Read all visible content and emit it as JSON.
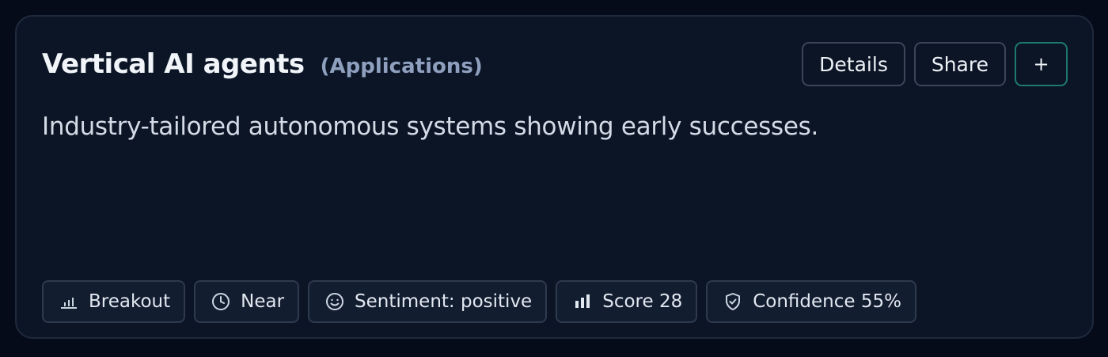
{
  "card": {
    "title": "Vertical AI agents",
    "category": "(Applications)",
    "description": "Industry-tailored autonomous systems showing early successes.",
    "actions": {
      "details_label": "Details",
      "share_label": "Share",
      "add_label": "+"
    },
    "chips": [
      {
        "icon": "bar-chart-icon",
        "label": "Breakout"
      },
      {
        "icon": "clock-icon",
        "label": "Near"
      },
      {
        "icon": "smiley-icon",
        "label": "Sentiment: positive"
      },
      {
        "icon": "signal-bars-icon",
        "label": "Score 28"
      },
      {
        "icon": "shield-check-icon",
        "label": "Confidence 55%"
      }
    ]
  },
  "colors": {
    "background": "#060b1a",
    "card": "#0c1526",
    "accent": "#1d7a6b",
    "muted_text": "#8fa0bf"
  }
}
